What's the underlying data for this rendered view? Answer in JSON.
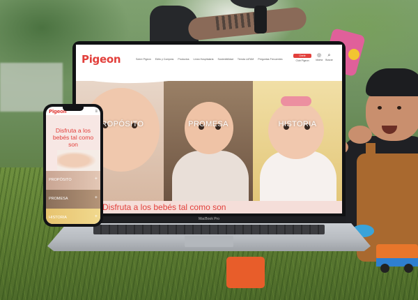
{
  "laptop": {
    "brand_label": "MacBook Pro",
    "site": {
      "logo": "Pigeon",
      "nav": [
        "Sobre Pigeon",
        "Edito y Compras",
        "Productos",
        "Línea Hospitalaria",
        "Sostenibilidad",
        "Tienda LATAM",
        "Preguntas Frecuentes"
      ],
      "club_tag": "Únete",
      "club_label": "Club Pigeon",
      "account": [
        {
          "icon": "globe-icon",
          "label": "Idioma"
        },
        {
          "icon": "search-icon",
          "label": "Buscar"
        }
      ],
      "panels": [
        {
          "label": "PROPÓSITO"
        },
        {
          "label": "PROMESA"
        },
        {
          "label": "HISTORIA"
        }
      ],
      "tagline": "Disfruta a los bebés tal como son"
    }
  },
  "phone": {
    "logo": "Pigeon",
    "menu_icon": "menu-icon",
    "headline": "Disfruta a los bebés tal como son",
    "panels": [
      {
        "label": "PROPÓSITO"
      },
      {
        "label": "PROMESA"
      },
      {
        "label": "HISTORIA"
      }
    ]
  },
  "colors": {
    "brand": "#e2403c",
    "band": "#f5ded9"
  }
}
